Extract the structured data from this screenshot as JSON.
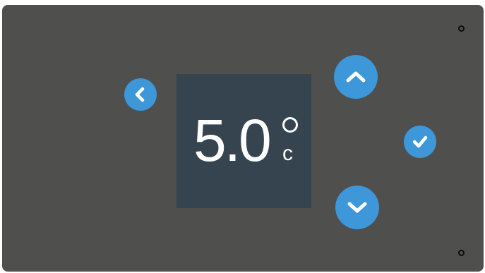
{
  "display": {
    "temperature": "5.0",
    "unit": "c"
  },
  "buttons": {
    "back": {
      "icon": "chevron-left-icon"
    },
    "up": {
      "icon": "chevron-up-icon"
    },
    "down": {
      "icon": "chevron-down-icon"
    },
    "confirm": {
      "icon": "checkmark-icon"
    }
  },
  "colors": {
    "device_body": "#4f4f4d",
    "display_bg": "#36444f",
    "button_accent": "#3e97d8",
    "text": "#ffffff"
  }
}
